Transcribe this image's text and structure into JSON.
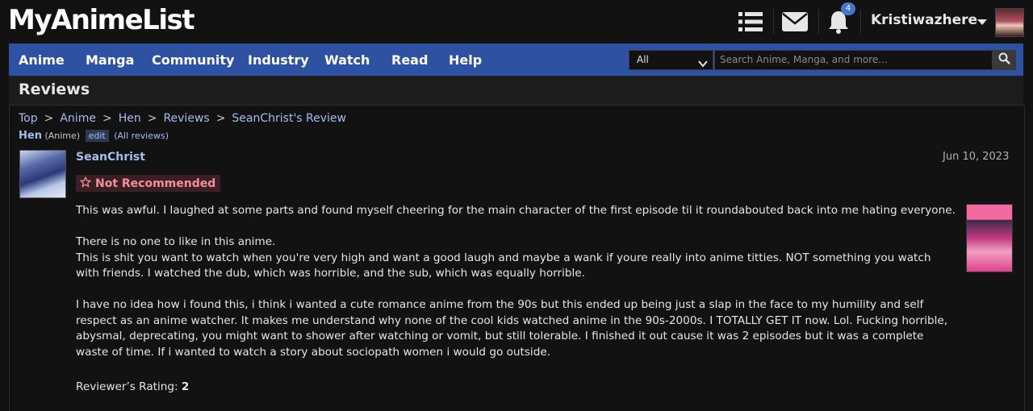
{
  "header": {
    "logo": "MyAnimeList",
    "notifications_count": "4",
    "username": "Kristiwazhere"
  },
  "nav": {
    "items": [
      "Anime",
      "Manga",
      "Community",
      "Industry",
      "Watch",
      "Read",
      "Help"
    ],
    "search_scope": "All",
    "search_placeholder": "Search Anime, Manga, and more..."
  },
  "page": {
    "title": "Reviews"
  },
  "breadcrumb": [
    "Top",
    "Anime",
    "Hen",
    "Reviews",
    "SeanChrist's Review"
  ],
  "subline": {
    "title": "Hen",
    "type": "(Anime)",
    "edit": "edit",
    "all_reviews": "(All reviews)"
  },
  "review": {
    "reviewer": "SeanChrist",
    "date": "Jun 10, 2023",
    "tag": "Not Recommended",
    "paragraphs": [
      "This was awful. I laughed at some parts and found myself cheering for the main character of the first episode til it roundabouted back into me hating everyone.",
      "There is no one to like in this anime.\nThis is shit you want to watch when you're very high and want a good laugh and maybe a wank if youre really into anime titties. NOT something you watch with friends. I watched the dub, which was horrible, and the sub, which was equally horrible.",
      "I have no idea how i found this, i think i wanted a cute romance anime from the 90s but this ended up being just a slap in the face to my humility and self respect as an anime watcher. It makes me understand why none of the cool kids watched anime in the 90s-2000s. I TOTALLY GET IT now. Lol. Fucking horrible, abysmal, deprecating, you might want to shower after watching or vomit, but still tolerable. I finished it out cause it was 2 episodes but it was a complete waste of time. If i wanted to watch a story about sociopath women i would go outside."
    ],
    "rating_label": "Reviewer’s Rating:",
    "rating_value": "2"
  },
  "colors": {
    "nav_bg": "#2e51a2",
    "link": "#a4bdf1",
    "tag_text": "#f58f9f",
    "tag_bg": "#3a1f25",
    "badge": "#4a74c9"
  },
  "icons": [
    "list-icon",
    "mail-icon",
    "bell-icon",
    "caret-down-icon",
    "search-icon",
    "star-outline-icon",
    "chevron-down-icon"
  ]
}
